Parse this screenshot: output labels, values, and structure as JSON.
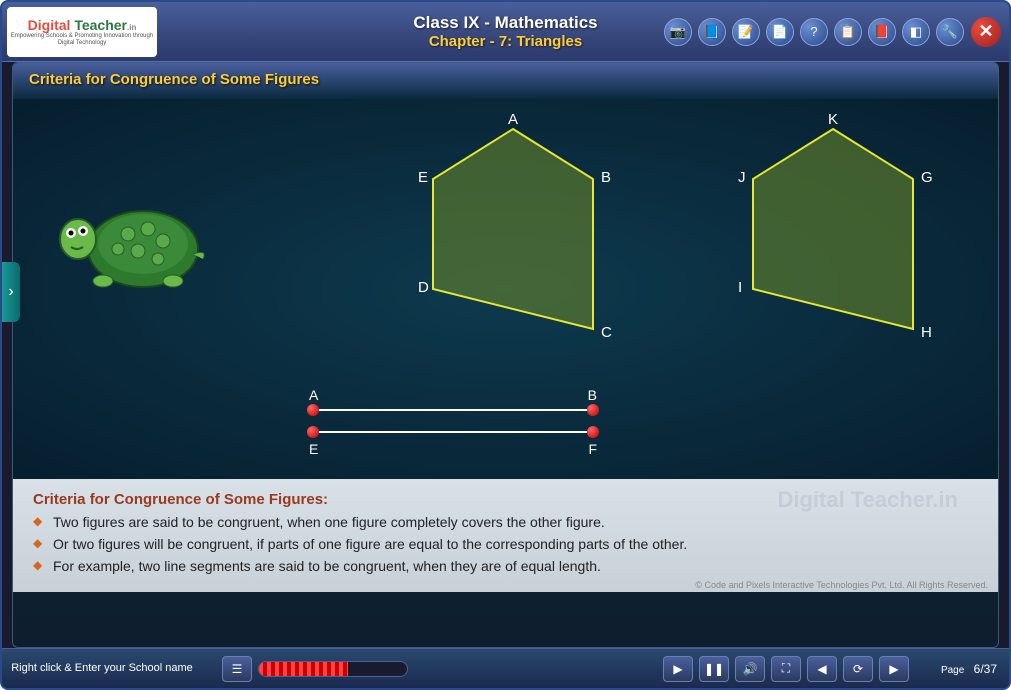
{
  "header": {
    "logo_text": "Digital Teacher",
    "logo_tagline": "Empowering Schools & Promoting Innovation through Digital Technology",
    "title_line1": "Class IX - Mathematics",
    "title_line2": "Chapter - 7: Triangles"
  },
  "section": {
    "title": "Criteria for Congruence of Some Figures"
  },
  "pentagon1": {
    "labels": {
      "top": "A",
      "right": "B",
      "bottom_right": "C",
      "bottom_left": "D",
      "left": "E"
    }
  },
  "pentagon2": {
    "labels": {
      "top": "K",
      "right": "G",
      "bottom_right": "H",
      "bottom_left": "I",
      "left": "J"
    }
  },
  "segments": {
    "seg1": {
      "start": "A",
      "end": "B"
    },
    "seg2": {
      "start": "E",
      "end": "F"
    }
  },
  "notes": {
    "heading": "Criteria for Congruence of Some Figures:",
    "items": [
      "Two figures are said to be congruent, when one figure completely covers the other figure.",
      "Or two figures will be congruent, if parts of one figure are equal to the corresponding parts of the other.",
      "For example, two line segments are said to be congruent, when they are of equal length."
    ],
    "watermark": "Digital Teacher.in",
    "copyright": "© Code and Pixels Interactive Technologies Pvt. Ltd. All Rights Reserved."
  },
  "footer": {
    "school_text": "Right click & Enter your School name",
    "page_label": "Page",
    "page_value": "6/37"
  },
  "icons": {
    "home": "⌂",
    "book": "📘",
    "note": "📝",
    "help": "?",
    "doc": "📄",
    "bookmark": "📕",
    "eraser": "◧",
    "tool": "🔧"
  }
}
